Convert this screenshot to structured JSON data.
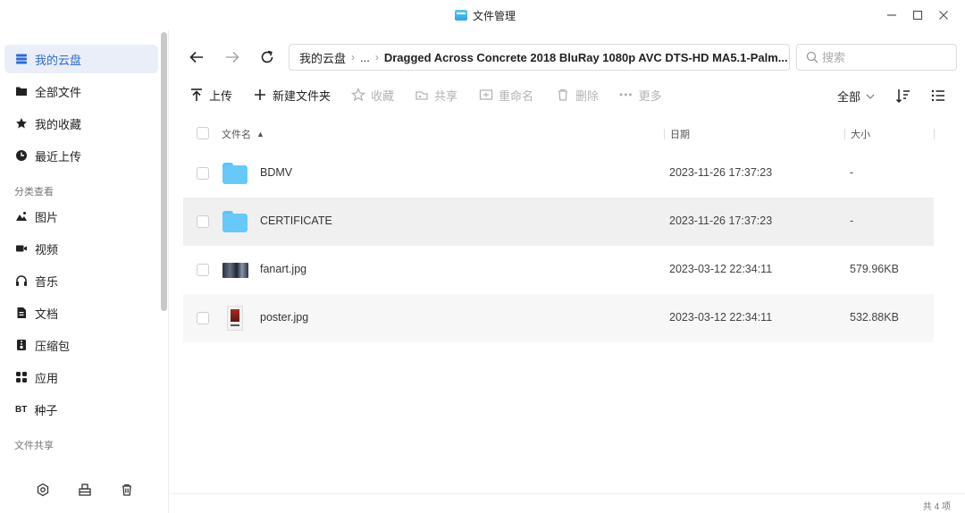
{
  "window": {
    "title": "文件管理",
    "icon": "file-manager-icon"
  },
  "sidebar": {
    "items": [
      {
        "label": "我的云盘",
        "icon": "cloud-drive-icon",
        "active": true
      },
      {
        "label": "全部文件",
        "icon": "folder-icon"
      },
      {
        "label": "我的收藏",
        "icon": "star-icon"
      },
      {
        "label": "最近上传",
        "icon": "clock-icon"
      }
    ],
    "group_category": "分类查看",
    "categories": [
      {
        "label": "图片",
        "icon": "image-icon"
      },
      {
        "label": "视频",
        "icon": "video-icon"
      },
      {
        "label": "音乐",
        "icon": "headphones-icon"
      },
      {
        "label": "文档",
        "icon": "document-icon"
      },
      {
        "label": "压缩包",
        "icon": "archive-icon"
      },
      {
        "label": "应用",
        "icon": "apps-icon"
      },
      {
        "label": "种子",
        "icon": "bt-icon",
        "icon_text": "BT"
      }
    ],
    "group_share": "文件共享"
  },
  "breadcrumb": {
    "root": "我的云盘",
    "ellipsis": "...",
    "current": "Dragged Across Concrete 2018 BluRay 1080p AVC DTS-HD MA5.1-Palm..."
  },
  "search": {
    "placeholder": "搜索",
    "value": ""
  },
  "toolbar": {
    "upload": "上传",
    "new_folder": "新建文件夹",
    "favorite": "收藏",
    "share": "共享",
    "rename": "重命名",
    "delete": "删除",
    "more": "更多",
    "filter": "全部"
  },
  "table": {
    "headers": {
      "name": "文件名",
      "date": "日期",
      "size": "大小"
    },
    "rows": [
      {
        "name": "BDMV",
        "type": "folder",
        "date": "2023-11-26 17:37:23",
        "size": "-"
      },
      {
        "name": "CERTIFICATE",
        "type": "folder",
        "date": "2023-11-26 17:37:23",
        "size": "-"
      },
      {
        "name": "fanart.jpg",
        "type": "image",
        "date": "2023-03-12 22:34:11",
        "size": "579.96KB"
      },
      {
        "name": "poster.jpg",
        "type": "image",
        "date": "2023-03-12 22:34:11",
        "size": "532.88KB"
      }
    ]
  },
  "status": {
    "count": "共 4 项"
  },
  "colors": {
    "accent": "#2c6bd9",
    "active_bg": "#e9eef8",
    "folder": "#66c9f8",
    "disabled": "#b3b3b3"
  }
}
